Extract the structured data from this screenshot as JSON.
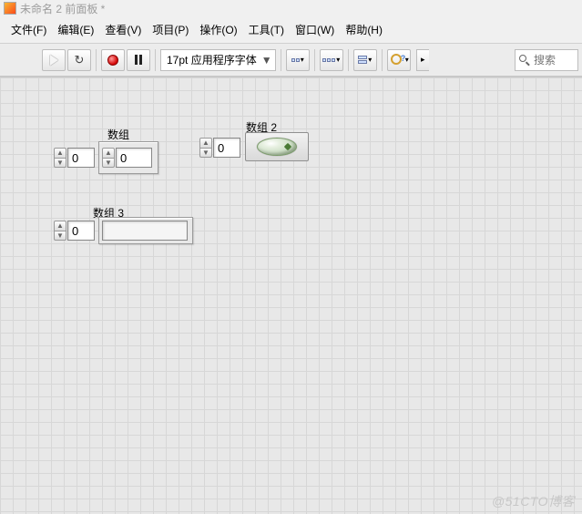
{
  "title": "未命名 2 前面板 *",
  "menu": {
    "file": "文件(F)",
    "edit": "编辑(E)",
    "view": "查看(V)",
    "project": "项目(P)",
    "operate": "操作(O)",
    "tools": "工具(T)",
    "window": "窗口(W)",
    "help": "帮助(H)"
  },
  "toolbar": {
    "font": "17pt 应用程序字体"
  },
  "search_placeholder": "搜索",
  "controls": {
    "array1": {
      "label": "数组",
      "index": "0",
      "value": "0"
    },
    "array2": {
      "label": "数组 2",
      "index": "0"
    },
    "array3": {
      "label": "数组 3",
      "index": "0"
    }
  },
  "watermark": "@51CTO博客"
}
